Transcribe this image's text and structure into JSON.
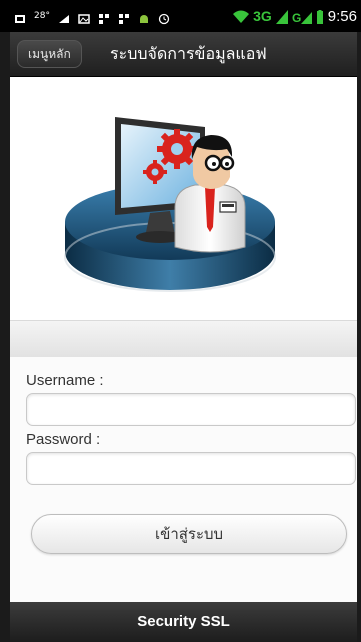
{
  "status_bar": {
    "temperature": "28°",
    "network": "3G",
    "time": "9:56",
    "icons": [
      "notification-icon",
      "weather-icon",
      "image-icon",
      "bbm-icon",
      "bbm-icon-2",
      "android-icon",
      "alarm-icon",
      "wifi-icon",
      "signal-icon",
      "signal-icon-2",
      "battery-icon"
    ]
  },
  "app_bar": {
    "menu_label": "เมนูหลัก",
    "title": "ระบบจัดการข้อมูลแอฟ"
  },
  "hero": {
    "illustration": "admin-computer-illustration"
  },
  "form": {
    "username_label": "Username :",
    "username_value": "",
    "password_label": "Password :",
    "password_value": "",
    "login_label": "เข้าสู่ระบบ"
  },
  "footer": {
    "text": "Security SSL"
  },
  "colors": {
    "bar_dark": "#2b2b2b",
    "platform_blue": "#1d5f88",
    "gear_red": "#d9231d",
    "network_green": "#39c43b"
  }
}
